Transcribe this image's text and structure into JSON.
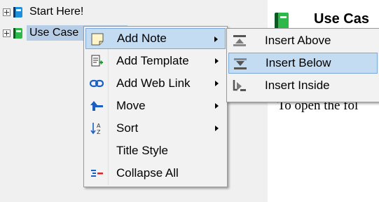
{
  "tree": {
    "items": [
      {
        "label": "Start Here!",
        "icon": "blue-notebook-icon"
      },
      {
        "label": "Use Case",
        "icon": "green-notebook-icon",
        "selected": true
      }
    ]
  },
  "content": {
    "title": "Use Cas",
    "body_text": "To open the fol",
    "icon": "green-notebook-icon"
  },
  "context_menu": {
    "items": [
      {
        "label": "Add Note",
        "icon": "note-icon",
        "submenu": true,
        "highlighted": true
      },
      {
        "label": "Add Template",
        "icon": "template-icon",
        "submenu": true
      },
      {
        "label": "Add Web Link",
        "icon": "link-icon",
        "submenu": true
      },
      {
        "label": "Move",
        "icon": "move-up-arrow-icon",
        "submenu": true
      },
      {
        "label": "Sort",
        "icon": "sort-az-icon",
        "submenu": true
      },
      {
        "label": "Title Style",
        "icon": "",
        "submenu": false
      },
      {
        "label": "Collapse All",
        "icon": "collapse-all-icon",
        "submenu": false
      }
    ]
  },
  "submenu": {
    "items": [
      {
        "label": "Insert Above",
        "icon": "insert-above-icon"
      },
      {
        "label": "Insert Below",
        "icon": "insert-below-icon",
        "highlighted": true
      },
      {
        "label": "Insert Inside",
        "icon": "insert-inside-icon"
      }
    ]
  },
  "colors": {
    "selection": "#b7cde6",
    "menu_highlight": "#c4dcf2",
    "blue_notebook": "#1e8fd8",
    "green_notebook": "#2fb84a"
  }
}
